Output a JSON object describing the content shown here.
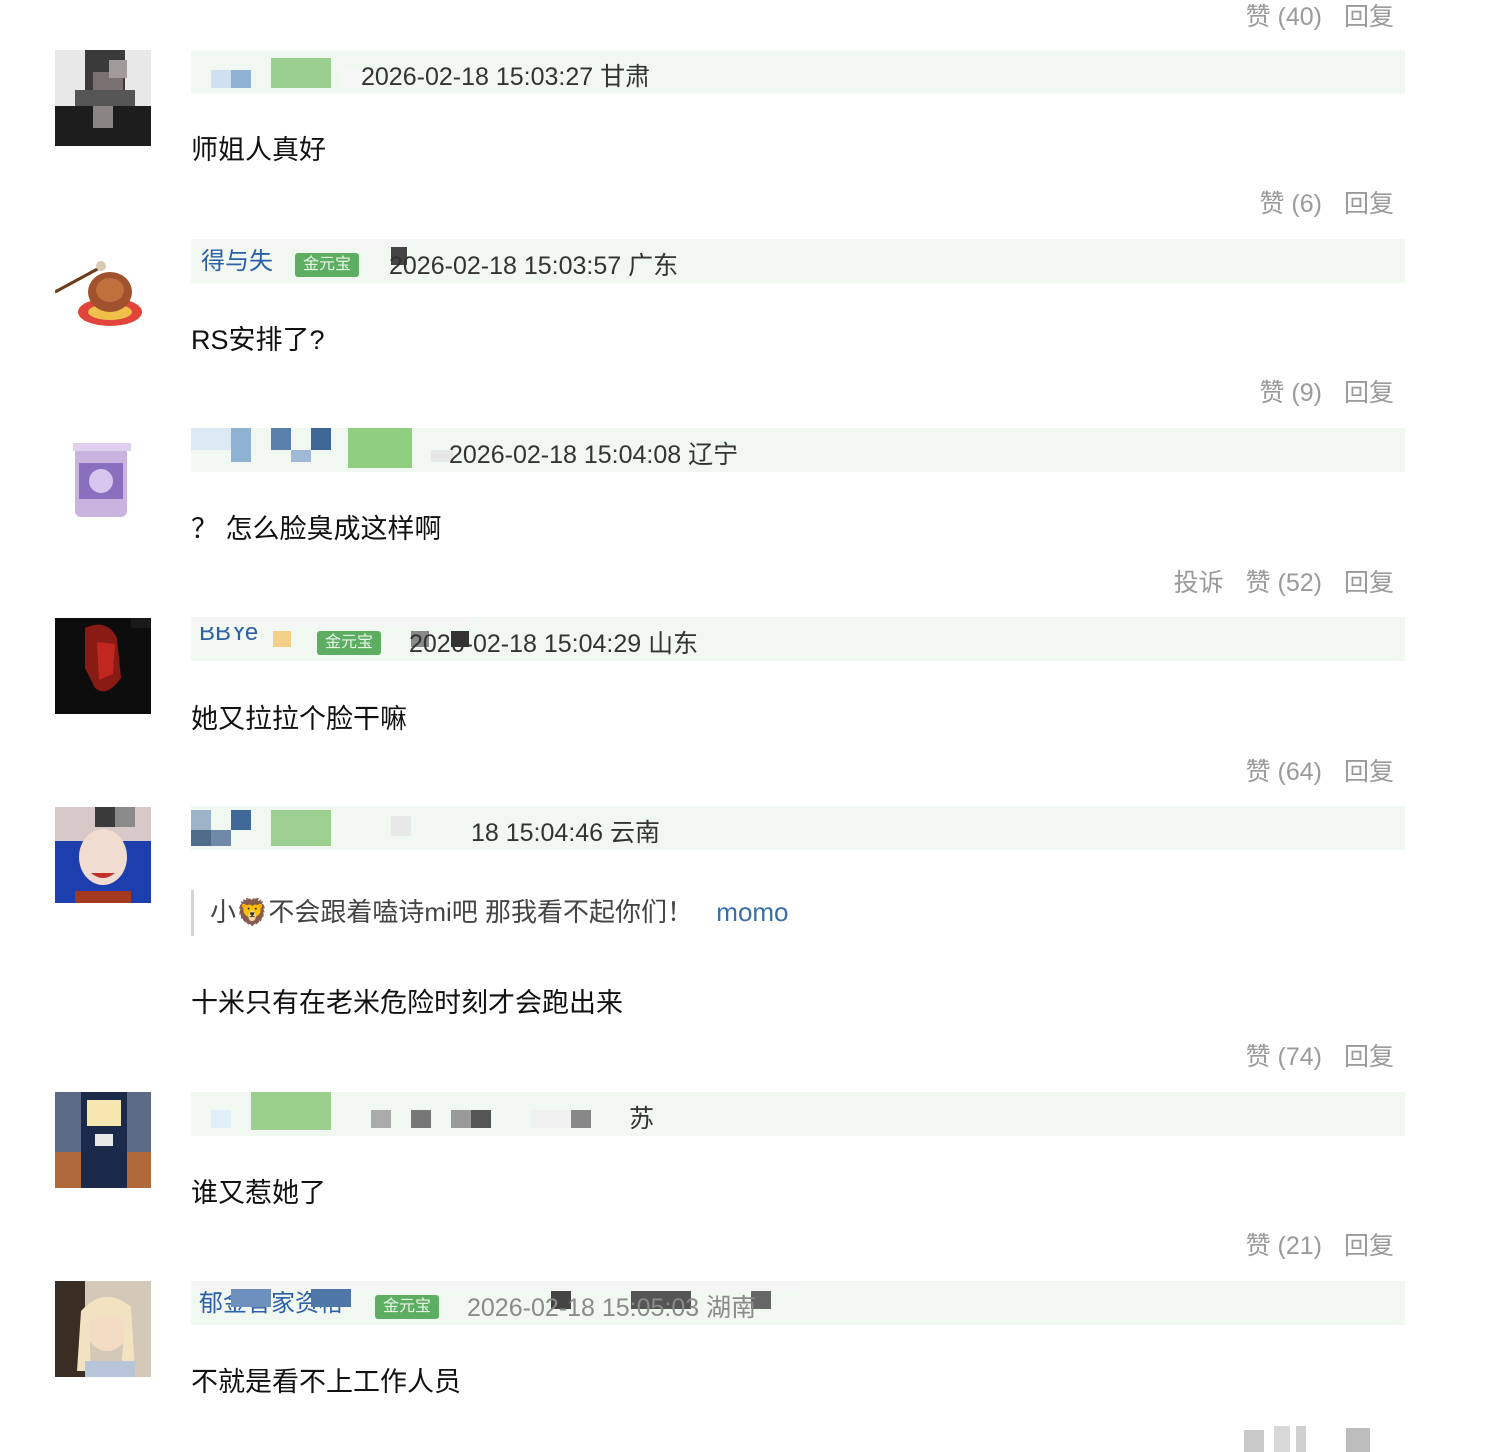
{
  "comments": [
    {
      "location_time": "2026-02-18 15:03:27 甘肃",
      "text": "师姐人真好",
      "likes": "赞 (6)",
      "reply": "回复"
    },
    {
      "name": "得与失",
      "badge": "金元宝",
      "location_time": "2026-02-18 15:03:57 广东",
      "text": "RS安排了?",
      "likes": "赞 (9)",
      "reply": "回复"
    },
    {
      "location_time": "2026-02-18 15:04:08 辽宁",
      "text": "？ 怎么脸臭成这样啊",
      "report": "投诉",
      "likes": "赞 (52)",
      "reply": "回复"
    },
    {
      "name": "BBYe",
      "badge": "金元宝",
      "location_time": "2026-02-18 15:04:29 山东",
      "text": "她又拉拉个脸干嘛",
      "likes": "赞 (64)",
      "reply": "回复"
    },
    {
      "location_time": "18 15:04:46 云南",
      "quote": "小🦁不会跟着嗑诗mi吧 那我看不起你们！",
      "quote_link": "momo",
      "text": "十米只有在老米危险时刻才会跑出来",
      "likes": "赞 (74)",
      "reply": "回复"
    },
    {
      "location_time": "苏",
      "text": "谁又惹她了",
      "likes": "赞 (21)",
      "reply": "回复"
    },
    {
      "name": "郁金香家资格",
      "badge": "金元宝",
      "location_time": "2026-02-18 15:05:03 湖南",
      "text": "不就是看不上工作人员"
    }
  ],
  "top_actions": {
    "likes": "赞 (40)",
    "reply": "回复"
  },
  "colors": {
    "meta_bg": "#f1f7f1",
    "action_gray": "#9a9a9a",
    "badge_green": "#5dae62",
    "link_blue": "#3a6ea5"
  }
}
